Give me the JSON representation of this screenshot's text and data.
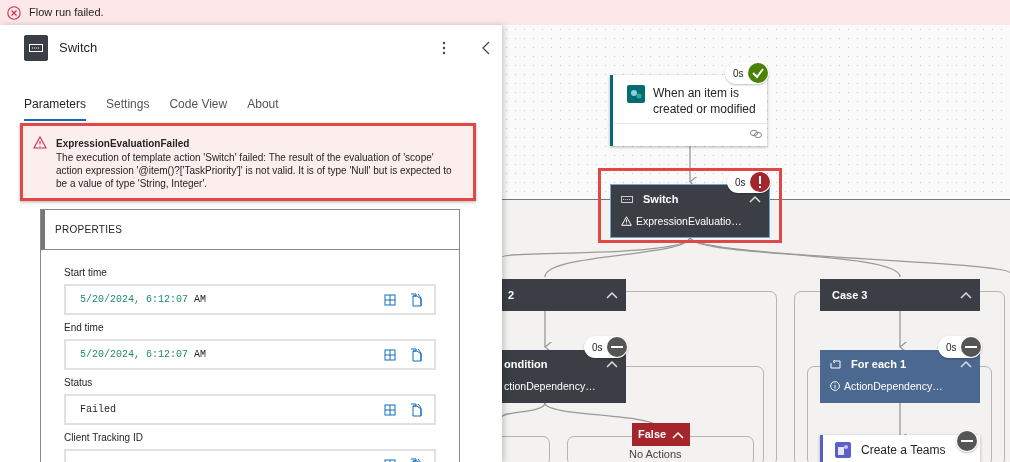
{
  "banner": {
    "kind": "error",
    "text": "Flow run failed."
  },
  "panel": {
    "title": "Switch",
    "tabs": [
      {
        "label": "Parameters",
        "selected": true
      },
      {
        "label": "Settings",
        "selected": false
      },
      {
        "label": "Code View",
        "selected": false
      },
      {
        "label": "About",
        "selected": false
      }
    ],
    "error": {
      "title": "ExpressionEvaluationFailed",
      "message": "The execution of template action 'Switch' failed: The result of the evaluation of 'scope' action expression '@item()?['TaskPriority']' is not valid. It is of type 'Null' but is expected to be a value of type 'String, Integer'.",
      "highlighted": true
    },
    "properties": {
      "heading": "PROPERTIES",
      "fields": [
        {
          "label": "Start time",
          "value_parts": [
            {
              "text": "5/20/2024, 6:12:07",
              "kind": "number"
            },
            {
              "text": "AM",
              "kind": "plain"
            }
          ]
        },
        {
          "label": "End time",
          "value_parts": [
            {
              "text": "5/20/2024, 6:12:07",
              "kind": "number"
            },
            {
              "text": "AM",
              "kind": "plain"
            }
          ]
        },
        {
          "label": "Status",
          "value_parts": [
            {
              "text": "Failed",
              "kind": "plain"
            }
          ]
        },
        {
          "label": "Client Tracking ID"
        }
      ]
    }
  },
  "canvas": {
    "nodes": [
      {
        "kind": "trigger",
        "title": "When an item is created or modified",
        "badge": {
          "text": "0s",
          "kind": "succeeded"
        }
      },
      {
        "kind": "action",
        "title": "Switch",
        "subtitle": {
          "text": "ExpressionEvaluatio…",
          "kind": "warning"
        },
        "badge": {
          "text": "0s",
          "kind": "failed"
        },
        "highlighted": true
      },
      {
        "kind": "case",
        "title": "2"
      },
      {
        "kind": "case",
        "title": "Case 3"
      },
      {
        "kind": "action",
        "title": "ondition",
        "subtitle": {
          "text": "ctionDependency…",
          "kind": "plain"
        },
        "badge": {
          "text": "0s",
          "kind": "skipped"
        }
      },
      {
        "kind": "loop",
        "title": "For each 1",
        "subtitle": {
          "text": "ActionDependency…",
          "kind": "info"
        },
        "badge": {
          "text": "0s",
          "kind": "skipped"
        }
      },
      {
        "kind": "branch",
        "title": "False",
        "note": "No Actions"
      },
      {
        "kind": "teams",
        "title": "Create a Teams",
        "badge": {
          "kind": "skipped"
        }
      }
    ]
  }
}
